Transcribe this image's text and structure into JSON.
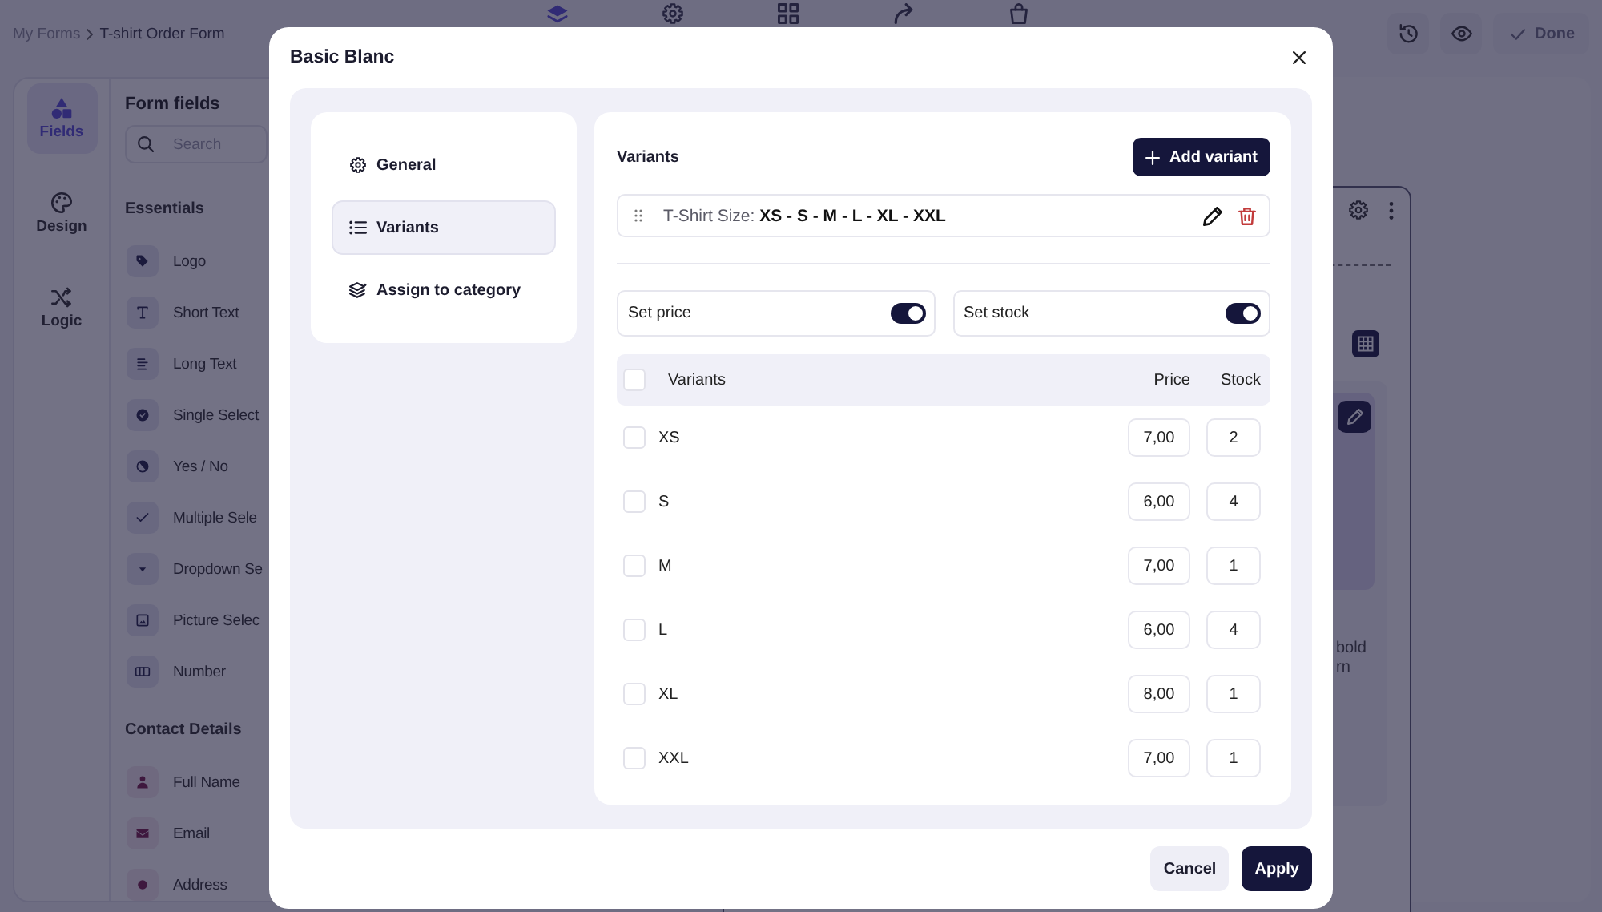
{
  "breadcrumb": {
    "parent": "My Forms",
    "current": "T-shirt Order Form"
  },
  "top_tabs": [
    {
      "selected": true
    },
    {
      "selected": false
    },
    {
      "selected": false
    },
    {
      "selected": false
    },
    {
      "selected": false
    }
  ],
  "toolbar": {
    "done": {
      "label": "Done",
      "disabled": true
    }
  },
  "rail": [
    {
      "label": "Fields",
      "selected": true
    },
    {
      "label": "Design",
      "selected": false
    },
    {
      "label": "Logic",
      "selected": false
    }
  ],
  "fields_panel": {
    "title": "Form fields",
    "search": {
      "placeholder": "Search"
    },
    "sections": [
      {
        "title": "Essentials",
        "kind": "basic",
        "items": [
          {
            "label": "Logo",
            "kind": "logo"
          },
          {
            "label": "Short Text",
            "kind": "short_text"
          },
          {
            "label": "Long Text",
            "kind": "long_text"
          },
          {
            "label": "Single Select",
            "kind": "single_select"
          },
          {
            "label": "Yes / No",
            "kind": "yes_no"
          },
          {
            "label": "Multiple Sele",
            "kind": "multiple_select"
          },
          {
            "label": "Dropdown Se",
            "kind": "dropdown"
          },
          {
            "label": "Picture Selec",
            "kind": "picture_select"
          },
          {
            "label": "Number",
            "kind": "number"
          }
        ]
      },
      {
        "title": "Contact Details",
        "kind": "contact",
        "items": [
          {
            "label": "Full Name",
            "kind": "full_name"
          },
          {
            "label": "Email",
            "kind": "email"
          },
          {
            "label": "Address",
            "kind": "address"
          }
        ]
      }
    ]
  },
  "canvas": {
    "text_lines": [
      "bold",
      "rn"
    ]
  },
  "modal": {
    "title": "Basic Blanc",
    "nav": [
      {
        "label": "General",
        "selected": false
      },
      {
        "label": "Variants",
        "selected": true
      },
      {
        "label": "Assign to category",
        "selected": false
      }
    ],
    "variants": {
      "heading": "Variants",
      "add_button": "Add variant",
      "groups": [
        {
          "text": "T-Shirt Size: **XS - S - M - L - XL - XXL**"
        }
      ],
      "toggles": [
        {
          "label": "Set price",
          "on": true
        },
        {
          "label": "Set stock",
          "on": true
        }
      ],
      "table": {
        "select_all": {
          "checked": false
        },
        "columns": [
          "Variants",
          "Price",
          "Stock"
        ],
        "rows": [
          {
            "label": "XS",
            "price": "7,00",
            "stock": "2",
            "checked": false
          },
          {
            "label": "S",
            "price": "6,00",
            "stock": "4",
            "checked": false
          },
          {
            "label": "M",
            "price": "7,00",
            "stock": "1",
            "checked": false
          },
          {
            "label": "L",
            "price": "6,00",
            "stock": "4",
            "checked": false
          },
          {
            "label": "XL",
            "price": "8,00",
            "stock": "1",
            "checked": false
          },
          {
            "label": "XXL",
            "price": "7,00",
            "stock": "1",
            "checked": false
          }
        ]
      }
    },
    "buttons": [
      {
        "label": "Cancel",
        "kind": "secondary"
      },
      {
        "label": "Apply",
        "kind": "primary"
      }
    ]
  }
}
